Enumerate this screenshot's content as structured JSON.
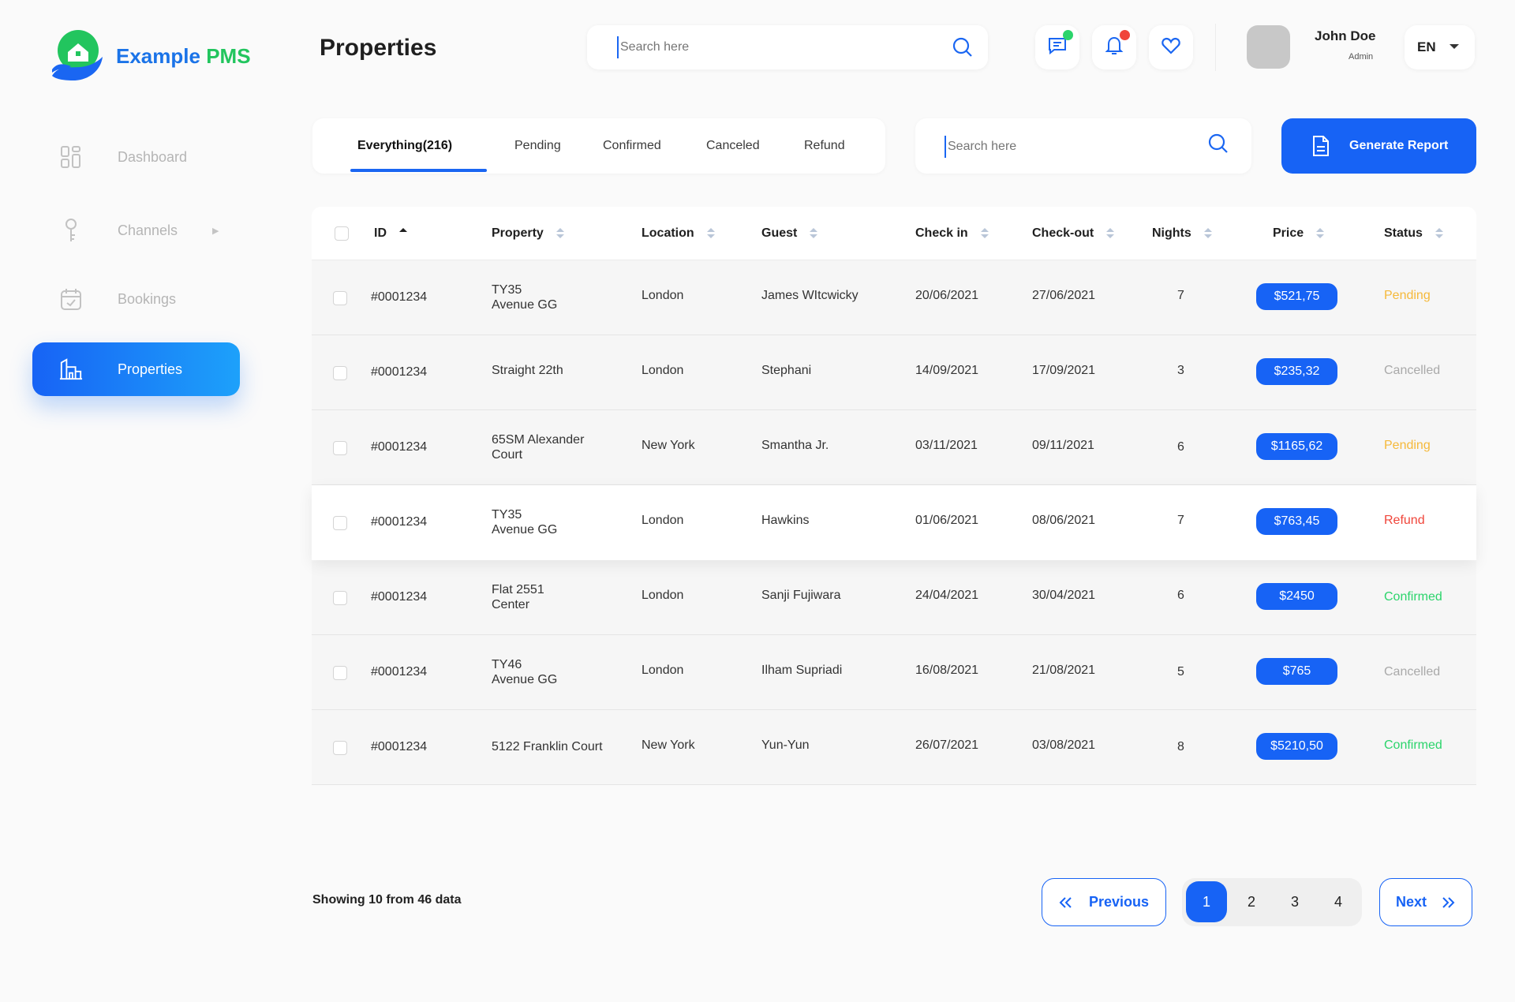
{
  "app": {
    "name_part1": "Example",
    "name_part2": "PMS"
  },
  "sidebar": {
    "items": [
      {
        "label": "Dashboard",
        "icon": "dashboard-icon"
      },
      {
        "label": "Channels",
        "icon": "key-icon"
      },
      {
        "label": "Bookings",
        "icon": "calendar-icon"
      },
      {
        "label": "Properties",
        "icon": "building-icon",
        "active": true
      }
    ]
  },
  "header": {
    "title": "Properties",
    "search_placeholder": "Search here",
    "user_name": "John Doe",
    "user_role": "Admin",
    "language": "EN"
  },
  "tabs": [
    "Everything(216)",
    "Pending",
    "Confirmed",
    "Canceled",
    "Refund"
  ],
  "tab_search_placeholder": "Search here",
  "generate_report_label": "Generate Report",
  "table": {
    "columns": [
      "ID",
      "Property",
      "Location",
      "Guest",
      "Check in",
      "Check-out",
      "Nights",
      "Price",
      "Status"
    ],
    "rows": [
      {
        "id": "#0001234",
        "property": [
          "TY35",
          "Avenue GG"
        ],
        "location": "London",
        "guest": "James WItcwicky",
        "check_in": "20/06/2021",
        "check_out": "27/06/2021",
        "nights": "7",
        "price": "$521,75",
        "status": "Pending"
      },
      {
        "id": "#0001234",
        "property": [
          "Straight 22th"
        ],
        "location": "London",
        "guest": "Stephani",
        "check_in": "14/09/2021",
        "check_out": "17/09/2021",
        "nights": "3",
        "price": "$235,32",
        "status": "Cancelled"
      },
      {
        "id": "#0001234",
        "property": [
          "65SM Alexander",
          "Court"
        ],
        "location": "New York",
        "guest": "Smantha Jr.",
        "check_in": "03/11/2021",
        "check_out": "09/11/2021",
        "nights": "6",
        "price": "$1165,62",
        "status": "Pending"
      },
      {
        "id": "#0001234",
        "property": [
          "TY35",
          "Avenue GG"
        ],
        "location": "London",
        "guest": "Hawkins",
        "check_in": "01/06/2021",
        "check_out": "08/06/2021",
        "nights": "7",
        "price": "$763,45",
        "status": "Refund"
      },
      {
        "id": "#0001234",
        "property": [
          "Flat 2551",
          "Center"
        ],
        "location": "London",
        "guest": "Sanji Fujiwara",
        "check_in": "24/04/2021",
        "check_out": "30/04/2021",
        "nights": "6",
        "price": "$2450",
        "status": "Confirmed"
      },
      {
        "id": "#0001234",
        "property": [
          "TY46",
          "Avenue GG"
        ],
        "location": "London",
        "guest": "Ilham Supriadi",
        "check_in": "16/08/2021",
        "check_out": "21/08/2021",
        "nights": "5",
        "price": "$765",
        "status": "Cancelled"
      },
      {
        "id": "#0001234",
        "property": [
          "5122 Franklin Court"
        ],
        "location": "New York",
        "guest": "Yun-Yun",
        "check_in": "26/07/2021",
        "check_out": "03/08/2021",
        "nights": "8",
        "price": "$5210,50",
        "status": "Confirmed"
      }
    ]
  },
  "status_colors": {
    "Pending": "#f5b93a",
    "Cancelled": "#a9a9a9",
    "Refund": "#f0453a",
    "Confirmed": "#2bd46b"
  },
  "colors": {
    "accent": "#1763f5",
    "brand_green": "#22c55e"
  },
  "pagination": {
    "showing": "Showing 10 from 46 data",
    "previous": "Previous",
    "next": "Next",
    "pages": [
      "1",
      "2",
      "3",
      "4"
    ],
    "current": "1"
  }
}
